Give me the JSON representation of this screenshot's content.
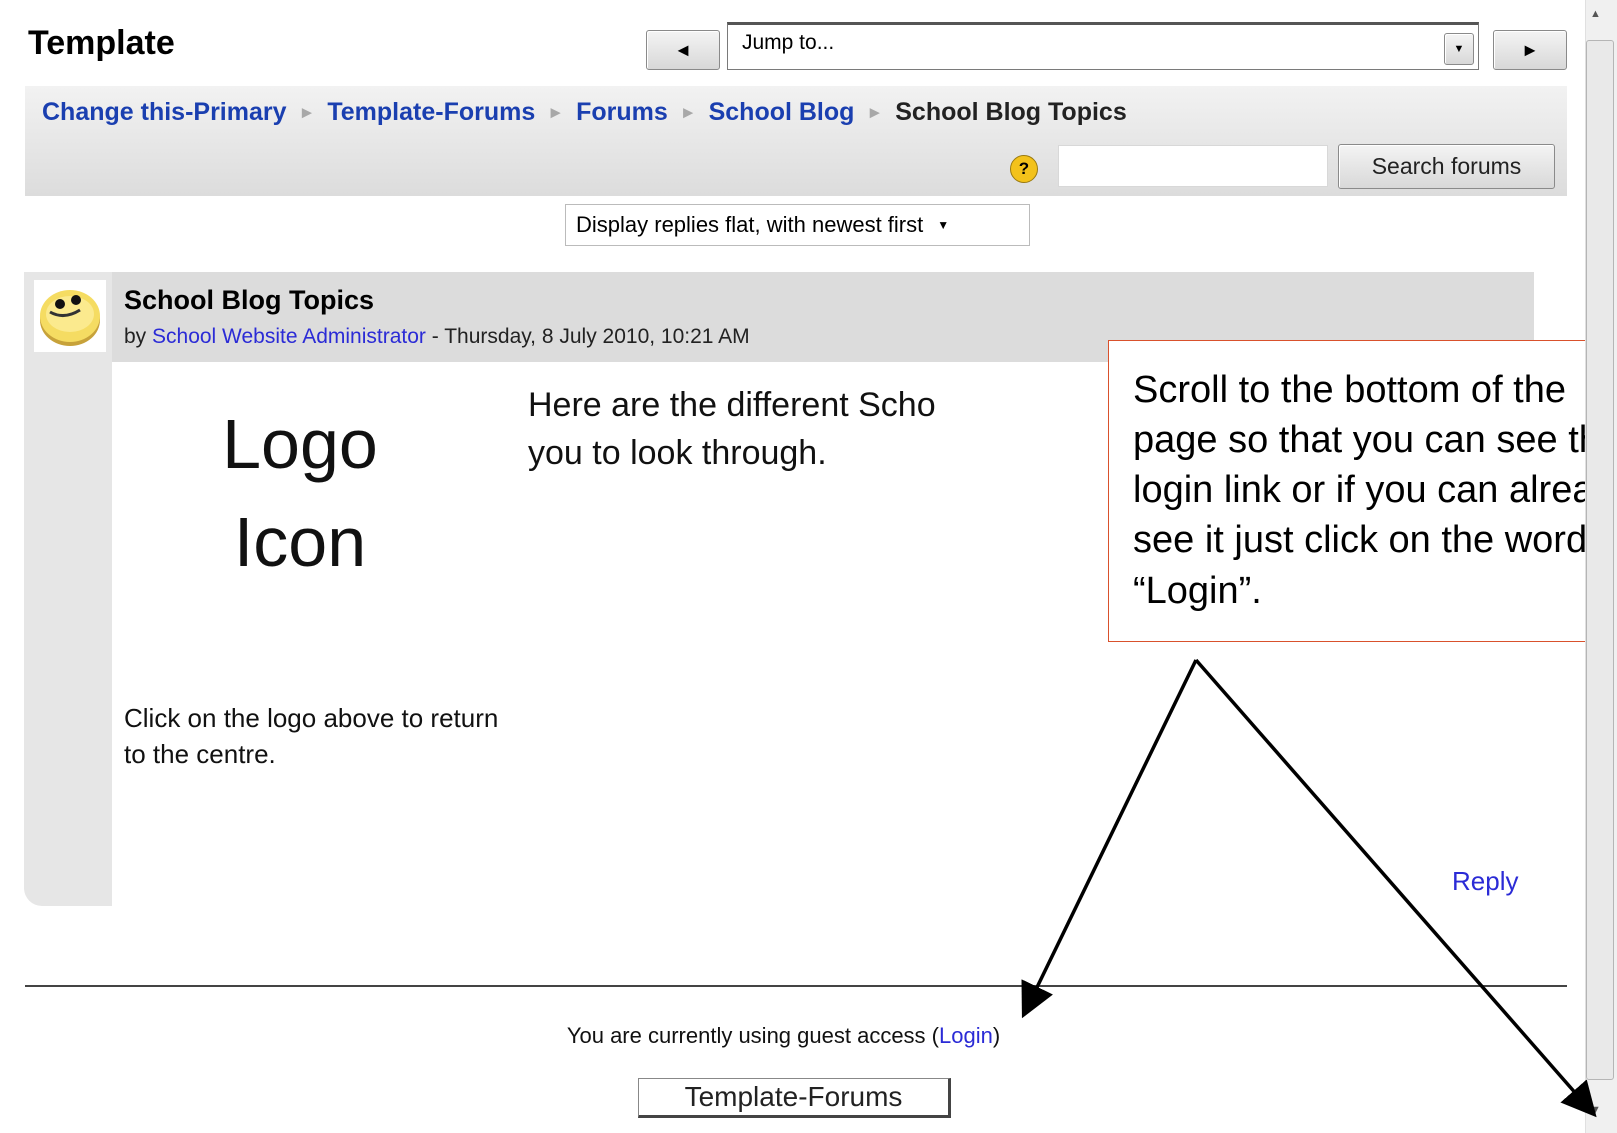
{
  "header": {
    "title": "Template",
    "prev_icon": "◄",
    "next_icon": "►",
    "jump_to": "Jump to...",
    "dropdown_icon": "▼"
  },
  "breadcrumb": {
    "items": [
      "Change this-Primary",
      "Template-Forums",
      "Forums",
      "School Blog"
    ],
    "current": "School Blog Topics",
    "separator": "►"
  },
  "search": {
    "help_icon": "?",
    "value": "",
    "button_label": "Search forums"
  },
  "display_mode": {
    "selected": "Display replies flat, with newest first",
    "dropdown_icon": "▼"
  },
  "post": {
    "title": "School Blog Topics",
    "by_prefix": "by ",
    "author": "School Website Administrator",
    "date": " - Thursday, 8 July 2010, 10:21 AM",
    "logo_line1": "Logo",
    "logo_line2": "Icon",
    "logo_caption": "Click on the logo above to return to the centre.",
    "message": "Here are the different Scho",
    "message_line2": "you to look through.",
    "reply_label": "Reply"
  },
  "callout": {
    "text": "Scroll to the bottom of the page so that you can see the login link or if you can already see it just click on the word “Login”."
  },
  "footer": {
    "guest_text": "You are currently using guest access (",
    "login_label": "Login",
    "guest_close": ")",
    "home_button": "Template-Forums"
  },
  "scrollbar": {
    "up_icon": "▲",
    "down_icon": "▼"
  }
}
